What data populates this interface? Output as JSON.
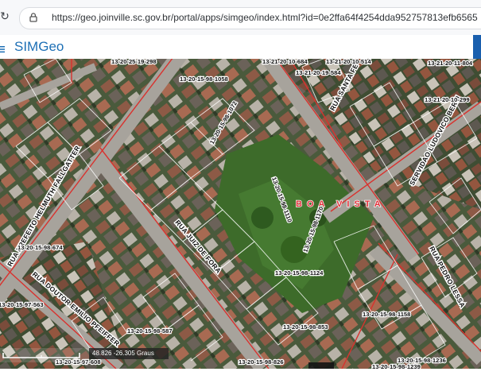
{
  "browser": {
    "url": "https://geo.joinville.sc.gov.br/portal/apps/simgeo/index.html?id=0e2ffa64f4254dda952757813efb6565",
    "icons": [
      "back-icon",
      "reload-icon",
      "site-info-icon"
    ]
  },
  "app": {
    "title": "SIMGeo",
    "menu_icon": "hamburger-icon"
  },
  "map": {
    "neighborhood": "BOA VISTA",
    "coordinates": "48.826 -26.305 Graus",
    "streets": [
      "RUA PREFEITO HELMUTH FALLGATTER",
      "RUA DOUTOR EMILIO PFEIFFER",
      "RUA JUIZ DE FORA",
      "RUA SANTA FE",
      "SERVIDAO LUDOVICO BERTI",
      "RUA PEDRO LESSA"
    ],
    "lots": [
      "13-20-15-98-1058",
      "13-21-20-19-584",
      "13-21-20-10-514",
      "13-21-20-10-684",
      "13-21-20-11-804",
      "13-20-15-98-1124",
      "13-20-15-98-853",
      "13-20-15-98-1158",
      "13-20-15-98-674",
      "13-20-15-98-587",
      "13-20-15-97-563",
      "13-20-15-97-608",
      "13-20-15-98-1239",
      "13-20-15-98-1236",
      "13-20-25-19-298",
      "13-20-15-98-826",
      "13-21-20-10-299",
      "13-20-15-98-1170",
      "13-20-15-98-1110",
      "13-20-15-98-1072"
    ]
  }
}
